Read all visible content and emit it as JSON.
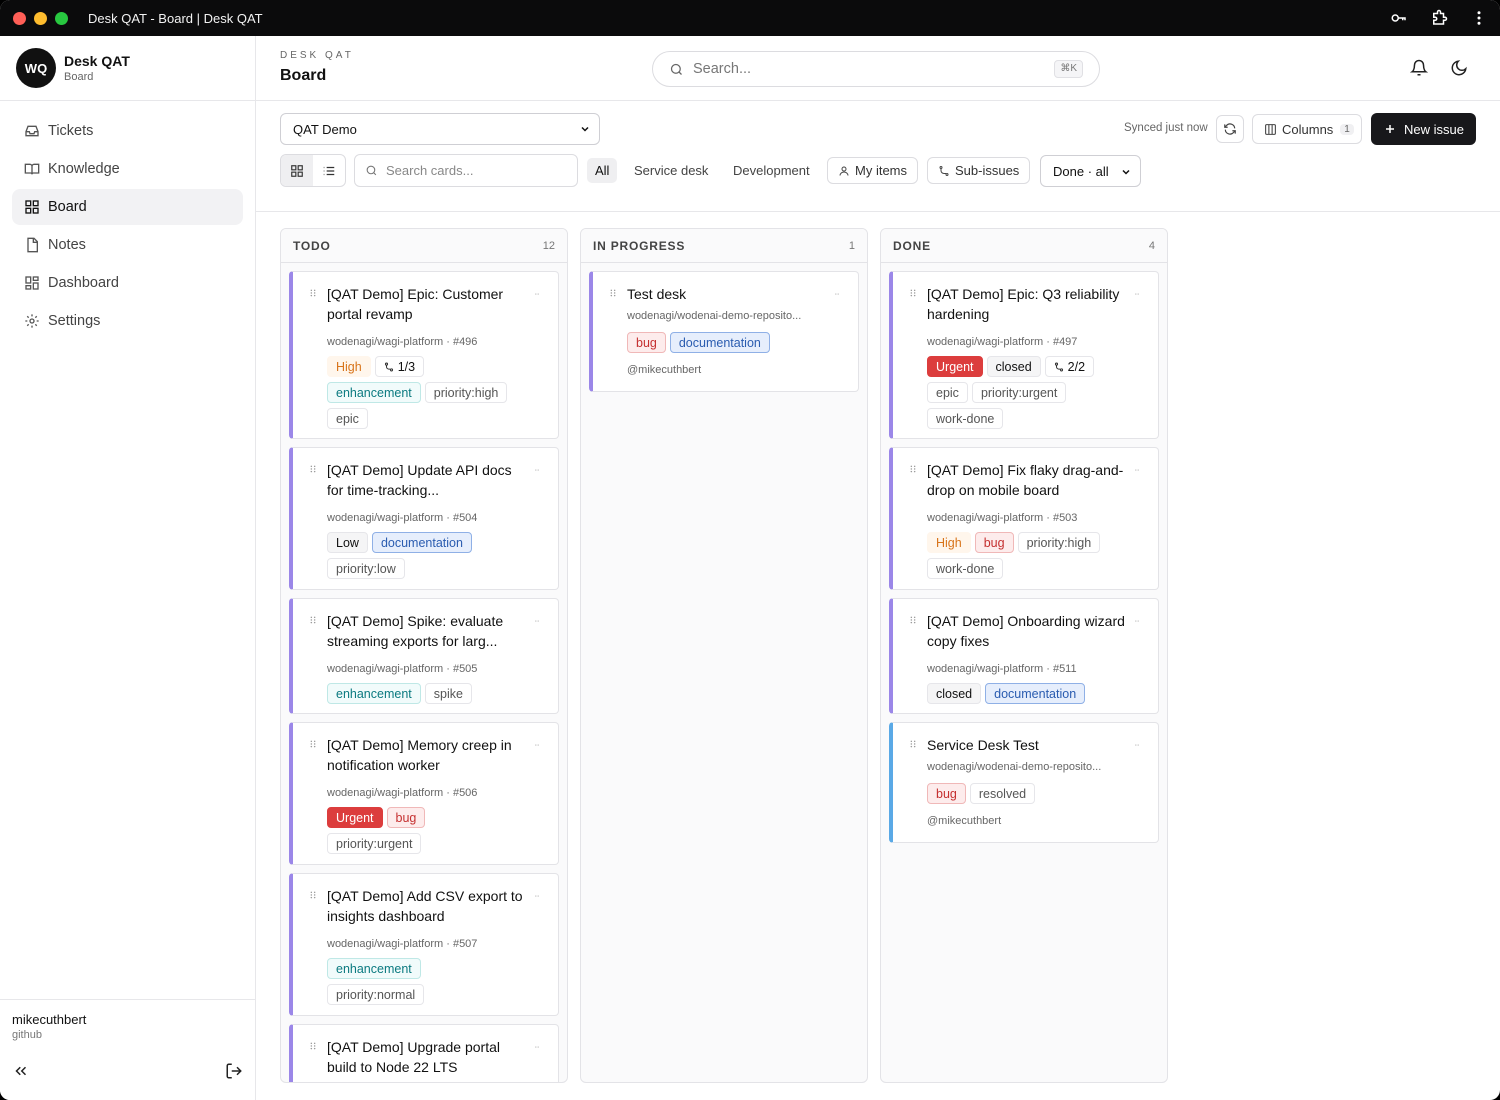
{
  "window": {
    "title": "Desk QAT - Board | Desk QAT"
  },
  "sidebar": {
    "avatar": "WQ",
    "brand_name": "Desk QAT",
    "brand_sub": "Board",
    "items": [
      {
        "label": "Tickets",
        "icon": "inbox-icon"
      },
      {
        "label": "Knowledge",
        "icon": "book-icon"
      },
      {
        "label": "Board",
        "icon": "grid-icon",
        "active": true
      },
      {
        "label": "Notes",
        "icon": "file-icon"
      },
      {
        "label": "Dashboard",
        "icon": "dashboard-icon"
      },
      {
        "label": "Settings",
        "icon": "gear-icon"
      }
    ],
    "user_name": "mikecuthbert",
    "user_sub": "github"
  },
  "header": {
    "overline": "DESK QAT",
    "title": "Board",
    "search_placeholder": "Search...",
    "shortcut": "⌘K"
  },
  "toolbar": {
    "project": "QAT Demo",
    "synced": "Synced just now",
    "columns_label": "Columns",
    "columns_count": "1",
    "new_issue": "New issue",
    "card_search_placeholder": "Search cards...",
    "filters": [
      "All",
      "Service desk",
      "Development"
    ],
    "my_items": "My items",
    "sub_issues": "Sub-issues",
    "done_filter": "Done · all"
  },
  "columns": [
    {
      "title": "TODO",
      "count": "12",
      "cards": [
        {
          "title": "[QAT Demo] Epic: Customer portal revamp",
          "meta": "wodenagi/wagi-platform · #496",
          "rows": [
            [
              {
                "t": "High",
                "c": "high"
              },
              {
                "t": "1/3",
                "c": "sub"
              }
            ],
            [
              {
                "t": "enhancement",
                "c": "teal"
              },
              {
                "t": "priority:high",
                "c": "gray"
              }
            ],
            [
              {
                "t": "epic",
                "c": "gray"
              }
            ]
          ]
        },
        {
          "title": "[QAT Demo] Update API docs for time-tracking...",
          "meta": "wodenagi/wagi-platform · #504",
          "rows": [
            [
              {
                "t": "Low",
                "c": "dark"
              },
              {
                "t": "documentation",
                "c": "blue"
              }
            ],
            [
              {
                "t": "priority:low",
                "c": "gray"
              }
            ]
          ]
        },
        {
          "title": "[QAT Demo] Spike: evaluate streaming exports for larg...",
          "meta": "wodenagi/wagi-platform · #505",
          "rows": [
            [
              {
                "t": "enhancement",
                "c": "teal"
              },
              {
                "t": "spike",
                "c": "gray"
              }
            ]
          ]
        },
        {
          "title": "[QAT Demo] Memory creep in notification worker",
          "meta": "wodenagi/wagi-platform · #506",
          "rows": [
            [
              {
                "t": "Urgent",
                "c": "urgent"
              },
              {
                "t": "bug",
                "c": "red"
              }
            ],
            [
              {
                "t": "priority:urgent",
                "c": "gray"
              }
            ]
          ]
        },
        {
          "title": "[QAT Demo] Add CSV export to insights dashboard",
          "meta": "wodenagi/wagi-platform · #507",
          "rows": [
            [
              {
                "t": "enhancement",
                "c": "teal"
              }
            ],
            [
              {
                "t": "priority:normal",
                "c": "gray"
              }
            ]
          ]
        },
        {
          "title": "[QAT Demo] Upgrade portal build to Node 22 LTS",
          "meta": "",
          "rows": []
        }
      ]
    },
    {
      "title": "IN PROGRESS",
      "count": "1",
      "cards": [
        {
          "title": "Test desk",
          "meta": "wodenagi/wodenai-demo-reposito...",
          "rows": [
            [
              {
                "t": "bug",
                "c": "red"
              },
              {
                "t": "documentation",
                "c": "blue"
              }
            ]
          ],
          "assignee": "@mikecuthbert"
        }
      ]
    },
    {
      "title": "DONE",
      "count": "4",
      "cards": [
        {
          "title": "[QAT Demo] Epic: Q3 reliability hardening",
          "meta": "wodenagi/wagi-platform · #497",
          "rows": [
            [
              {
                "t": "Urgent",
                "c": "urgent"
              },
              {
                "t": "closed",
                "c": "dark"
              },
              {
                "t": "2/2",
                "c": "sub"
              }
            ],
            [
              {
                "t": "epic",
                "c": "gray"
              },
              {
                "t": "priority:urgent",
                "c": "gray"
              }
            ],
            [
              {
                "t": "work-done",
                "c": "gray"
              }
            ]
          ]
        },
        {
          "title": "[QAT Demo] Fix flaky drag-and-drop on mobile board",
          "meta": "wodenagi/wagi-platform · #503",
          "rows": [
            [
              {
                "t": "High",
                "c": "high"
              },
              {
                "t": "bug",
                "c": "red"
              },
              {
                "t": "priority:high",
                "c": "gray"
              }
            ],
            [
              {
                "t": "work-done",
                "c": "gray"
              }
            ]
          ]
        },
        {
          "title": "[QAT Demo] Onboarding wizard copy fixes",
          "meta": "wodenagi/wagi-platform · #511",
          "rows": [
            [
              {
                "t": "closed",
                "c": "dark"
              },
              {
                "t": "documentation",
                "c": "blue"
              }
            ]
          ]
        },
        {
          "title": "Service Desk Test",
          "meta": "wodenagi/wodenai-demo-reposito...",
          "rows": [
            [
              {
                "t": "bug",
                "c": "red"
              },
              {
                "t": "resolved",
                "c": "gray"
              }
            ]
          ],
          "assignee": "@mikecuthbert",
          "accent": "blue"
        }
      ]
    }
  ]
}
